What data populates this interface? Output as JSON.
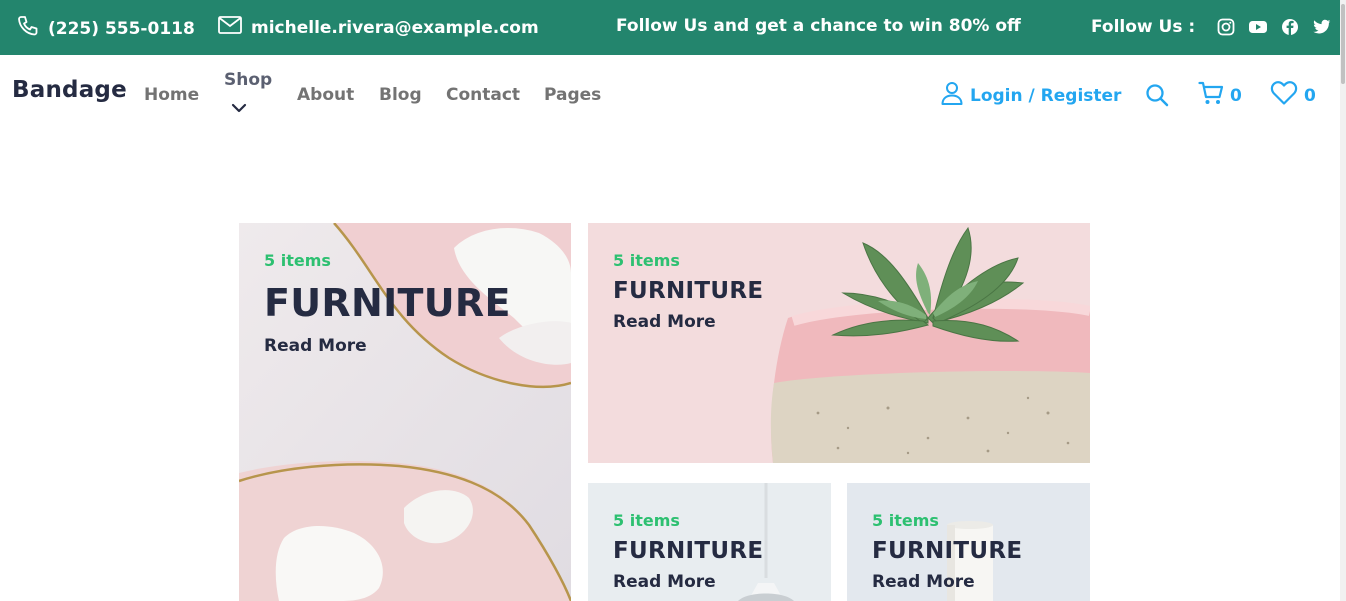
{
  "topbar": {
    "phone": "(225) 555-0118",
    "email": "michelle.rivera@example.com",
    "promo": "Follow Us  and get a chance to win 80% off",
    "follow_label": "Follow Us :",
    "icons": [
      "phone-icon",
      "mail-icon",
      "instagram-icon",
      "youtube-icon",
      "facebook-icon",
      "twitter-icon"
    ],
    "bg_color": "#23856d"
  },
  "nav": {
    "brand": "Bandage",
    "links": [
      "Home",
      "Shop",
      "About",
      "Blog",
      "Contact",
      "Pages"
    ],
    "login": "Login / Register",
    "cart_count": "0",
    "wishlist_count": "0",
    "accent_color": "#23a6f0"
  },
  "cards": [
    {
      "count": "5 items",
      "title": "FURNITURE",
      "link": "Read More"
    },
    {
      "count": "5 items",
      "title": "FURNITURE",
      "link": "Read More"
    },
    {
      "count": "5 items",
      "title": "FURNITURE",
      "link": "Read More"
    },
    {
      "count": "5 items",
      "title": "FURNITURE",
      "link": "Read More"
    }
  ],
  "colors": {
    "count_green": "#2dc071",
    "title_dark": "#252b42",
    "nav_gray": "#737373"
  }
}
